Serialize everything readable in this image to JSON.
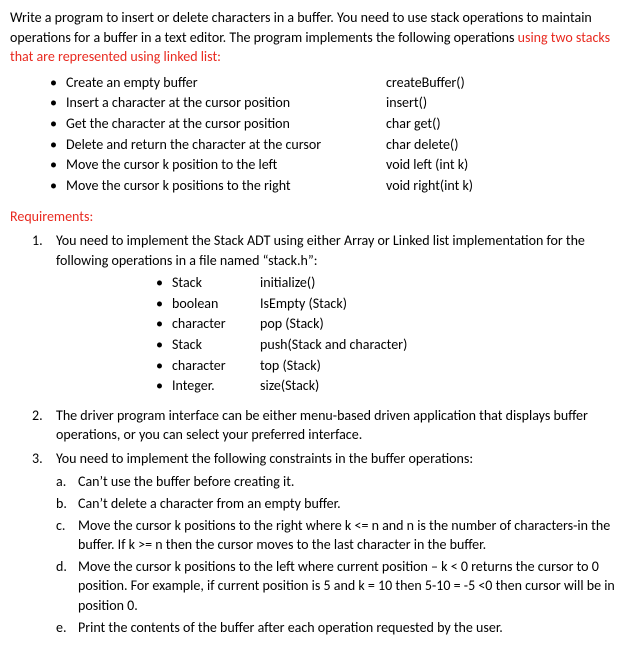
{
  "intro": {
    "pre": "Write a program to insert or delete characters in a buffer. You need to use stack operations to maintain operations for a buffer in a text editor. The program implements the following operations ",
    "red": "using two stacks that are represented using linked list:"
  },
  "ops": [
    {
      "desc": "Create an empty buffer",
      "fn": "createBuffer()"
    },
    {
      "desc": "Insert a character at the cursor position",
      "fn": "insert()"
    },
    {
      "desc": "Get the character at the cursor position",
      "fn": "char get()"
    },
    {
      "desc": "Delete and return the character at the cursor",
      "fn": "char delete()"
    },
    {
      "desc": "Move the cursor k position to the left",
      "fn": "void left (int k)"
    },
    {
      "desc": "Move the cursor k positions to the right",
      "fn": "void right(int k)"
    }
  ],
  "requirements_heading": "Requirements:",
  "req1": {
    "num": "1.",
    "text": "You need to implement the Stack ADT using either Array or Linked list implementation for the following operations in a file named “stack.h”:",
    "adt": [
      {
        "ret": "Stack",
        "fn": "initialize()"
      },
      {
        "ret": "boolean",
        "fn": "IsEmpty (Stack)"
      },
      {
        "ret": "character",
        "fn": "pop (Stack)"
      },
      {
        "ret": "Stack",
        "fn": "push(Stack and character)"
      },
      {
        "ret": "character",
        "fn": "top (Stack)"
      },
      {
        "ret": "Integer.",
        "fn": "size(Stack)"
      }
    ]
  },
  "req2": {
    "num": "2.",
    "text": "The driver program interface can be either menu-based driven application that displays buffer operations, or you can select your preferred interface."
  },
  "req3": {
    "num": "3.",
    "text": "You need to implement the following constraints in the buffer operations:",
    "subs": [
      {
        "label": "a.",
        "text": "Can’t use the buffer before creating it."
      },
      {
        "label": "b.",
        "text": "Can’t delete a character from an empty buffer."
      },
      {
        "label": "c.",
        "text": "Move the cursor k positions to the right where k <= n and n is the number of characters-in the buffer. If k >= n then the cursor moves to the last character in the buffer."
      },
      {
        "label": "d.",
        "text": "Move the cursor k positions to the left where current position – k < 0 returns the cursor to 0 position. For example, if current position is 5 and k = 10 then 5-10 = -5 <0 then cursor will be in position 0."
      },
      {
        "label": "e.",
        "text": "Print the contents of the buffer after each operation requested by the user."
      }
    ]
  },
  "bullet_char": "•"
}
